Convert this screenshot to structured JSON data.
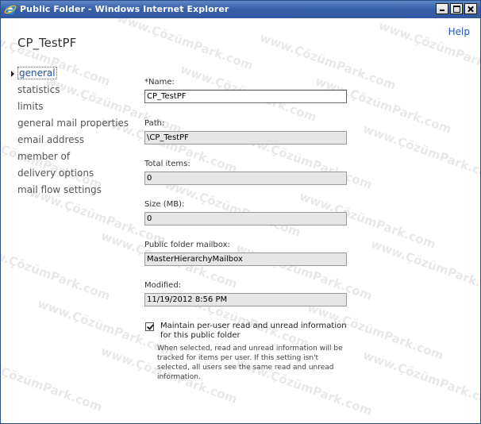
{
  "window": {
    "title": "Public Folder - Windows Internet Explorer",
    "icon": "ie-icon",
    "buttons": [
      "minimize-icon",
      "maximize-icon",
      "close-icon"
    ]
  },
  "help": {
    "label": "Help"
  },
  "page": {
    "title": "CP_TestPF"
  },
  "nav": {
    "items": [
      {
        "label": "general",
        "active": true
      },
      {
        "label": "statistics"
      },
      {
        "label": "limits"
      },
      {
        "label": "general mail properties"
      },
      {
        "label": "email address"
      },
      {
        "label": "member of"
      },
      {
        "label": "delivery options"
      },
      {
        "label": "mail flow settings"
      }
    ]
  },
  "form": {
    "name": {
      "label": "*Name:",
      "value": "CP_TestPF"
    },
    "path": {
      "label": "Path:",
      "value": "\\CP_TestPF"
    },
    "total_items": {
      "label": "Total items:",
      "value": "0"
    },
    "size": {
      "label": "Size (MB):",
      "value": "0"
    },
    "mailbox": {
      "label": "Public folder mailbox:",
      "value": "MasterHierarchyMailbox"
    },
    "modified": {
      "label": "Modified:",
      "value": "11/19/2012 8:56 PM"
    }
  },
  "read_unread": {
    "checked": true,
    "label": "Maintain per-user read and unread information for this public folder",
    "description": "When selected, read and unread information will be tracked for items per user. If this setting isn't selected, all users see the same read and unread information."
  },
  "watermark": {
    "text": "www.ÇözümPark.com"
  }
}
